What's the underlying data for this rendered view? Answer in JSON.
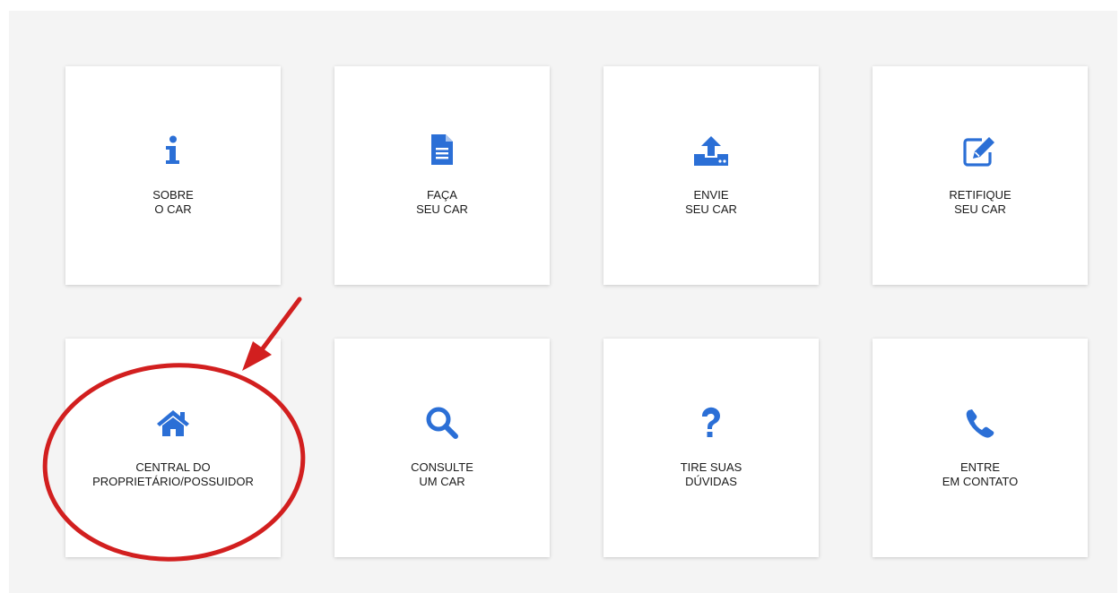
{
  "accent_color": "#2b6fd6",
  "annotation_color": "#d21f1f",
  "cards": [
    {
      "line1": "SOBRE",
      "line2": "O CAR",
      "icon": "info-icon"
    },
    {
      "line1": "FAÇA",
      "line2": "SEU CAR",
      "icon": "document-icon"
    },
    {
      "line1": "ENVIE",
      "line2": "SEU CAR",
      "icon": "upload-icon"
    },
    {
      "line1": "RETIFIQUE",
      "line2": "SEU CAR",
      "icon": "edit-icon"
    },
    {
      "line1": "CENTRAL DO",
      "line2": "PROPRIETÁRIO/POSSUIDOR",
      "icon": "home-icon"
    },
    {
      "line1": "CONSULTE",
      "line2": "UM CAR",
      "icon": "search-icon"
    },
    {
      "line1": "TIRE SUAS",
      "line2": "DÚVIDAS",
      "icon": "question-icon"
    },
    {
      "line1": "ENTRE",
      "line2": "EM CONTATO",
      "icon": "phone-icon"
    }
  ]
}
